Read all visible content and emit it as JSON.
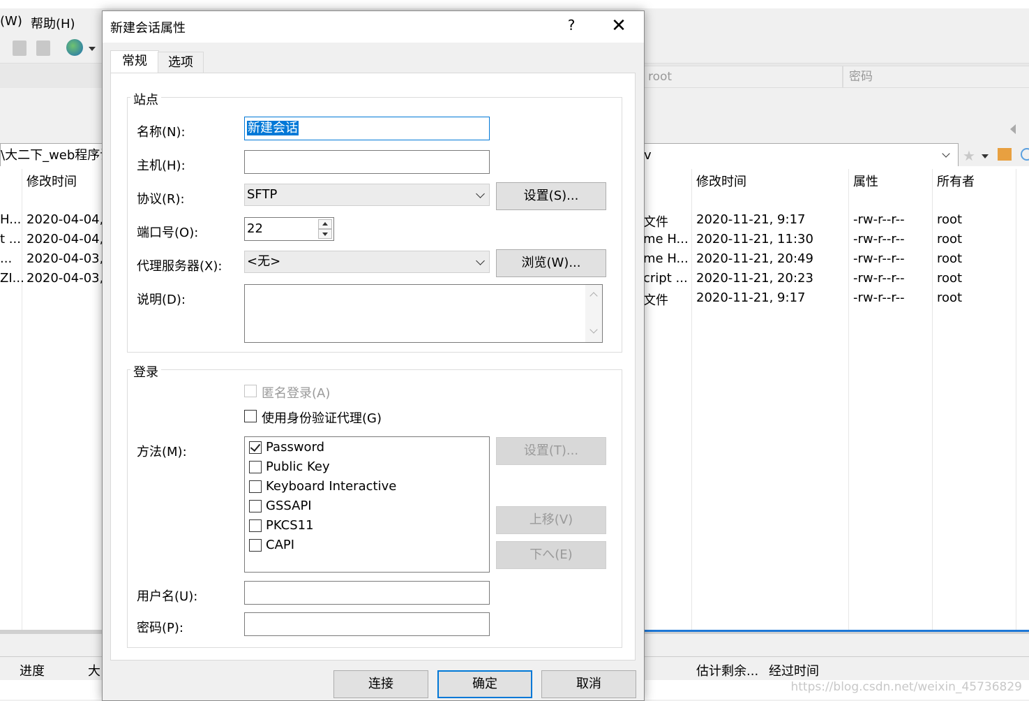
{
  "background": {
    "menu": [
      "(W)",
      "帮助(H)"
    ],
    "quickconnect": {
      "user_value": "root",
      "password_placeholder": "密码"
    },
    "local": {
      "path_fragment": "\\大二下_web程序设",
      "header_modified": "修改时间",
      "rows": [
        {
          "name": "H...",
          "modified": "2020-04-04,"
        },
        {
          "name": "t ...",
          "modified": "2020-04-04,"
        },
        {
          "name": "...",
          "modified": "2020-04-03,"
        },
        {
          "name": "ZI...",
          "modified": "2020-04-03,"
        }
      ]
    },
    "remote": {
      "path_fragment": "v",
      "headers": {
        "modified": "修改时间",
        "attrs": "属性",
        "owner": "所有者"
      },
      "rows": [
        {
          "name": "文件",
          "modified": "2020-11-21, 9:17",
          "attrs": "-rw-r--r--",
          "owner": "root"
        },
        {
          "name": "me H...",
          "modified": "2020-11-21, 11:30",
          "attrs": "-rw-r--r--",
          "owner": "root"
        },
        {
          "name": "me H...",
          "modified": "2020-11-21, 20:49",
          "attrs": "-rw-r--r--",
          "owner": "root"
        },
        {
          "name": "cript ...",
          "modified": "2020-11-21, 20:23",
          "attrs": "-rw-r--r--",
          "owner": "root"
        },
        {
          "name": "文件",
          "modified": "2020-11-21, 9:17",
          "attrs": "-rw-r--r--",
          "owner": "root"
        }
      ]
    },
    "queue": {
      "progress": "进度",
      "size": "大",
      "remaining": "估计剩余...",
      "elapsed": "经过时间"
    },
    "watermark": "https://blog.csdn.net/weixin_45736829"
  },
  "dialog": {
    "title": "新建会话属性",
    "help": "?",
    "close": "✕",
    "tabs": [
      "常规",
      "选项"
    ],
    "site": {
      "group": "站点",
      "name_label": "名称(N):",
      "name_value": "新建会话",
      "host_label": "主机(H):",
      "host_value": "",
      "protocol_label": "协议(R):",
      "protocol_value": "SFTP",
      "protocol_settings": "设置(S)...",
      "port_label": "端口号(O):",
      "port_value": "22",
      "proxy_label": "代理服务器(X):",
      "proxy_value": "<无>",
      "proxy_browse": "浏览(W)...",
      "desc_label": "说明(D):",
      "desc_value": ""
    },
    "login": {
      "group": "登录",
      "anonymous": "匿名登录(A)",
      "agent": "使用身份验证代理(G)",
      "method_label": "方法(M):",
      "methods": [
        {
          "label": "Password",
          "checked": true
        },
        {
          "label": "Public Key",
          "checked": false
        },
        {
          "label": "Keyboard Interactive",
          "checked": false
        },
        {
          "label": "GSSAPI",
          "checked": false
        },
        {
          "label": "PKCS11",
          "checked": false
        },
        {
          "label": "CAPI",
          "checked": false
        }
      ],
      "method_settings": "设置(T)...",
      "move_up": "上移(V)",
      "move_down": "下へ(E)",
      "username_label": "用户名(U):",
      "username_value": "",
      "password_label": "密码(P):",
      "password_value": ""
    },
    "buttons": {
      "connect": "连接",
      "ok": "确定",
      "cancel": "取消"
    }
  }
}
